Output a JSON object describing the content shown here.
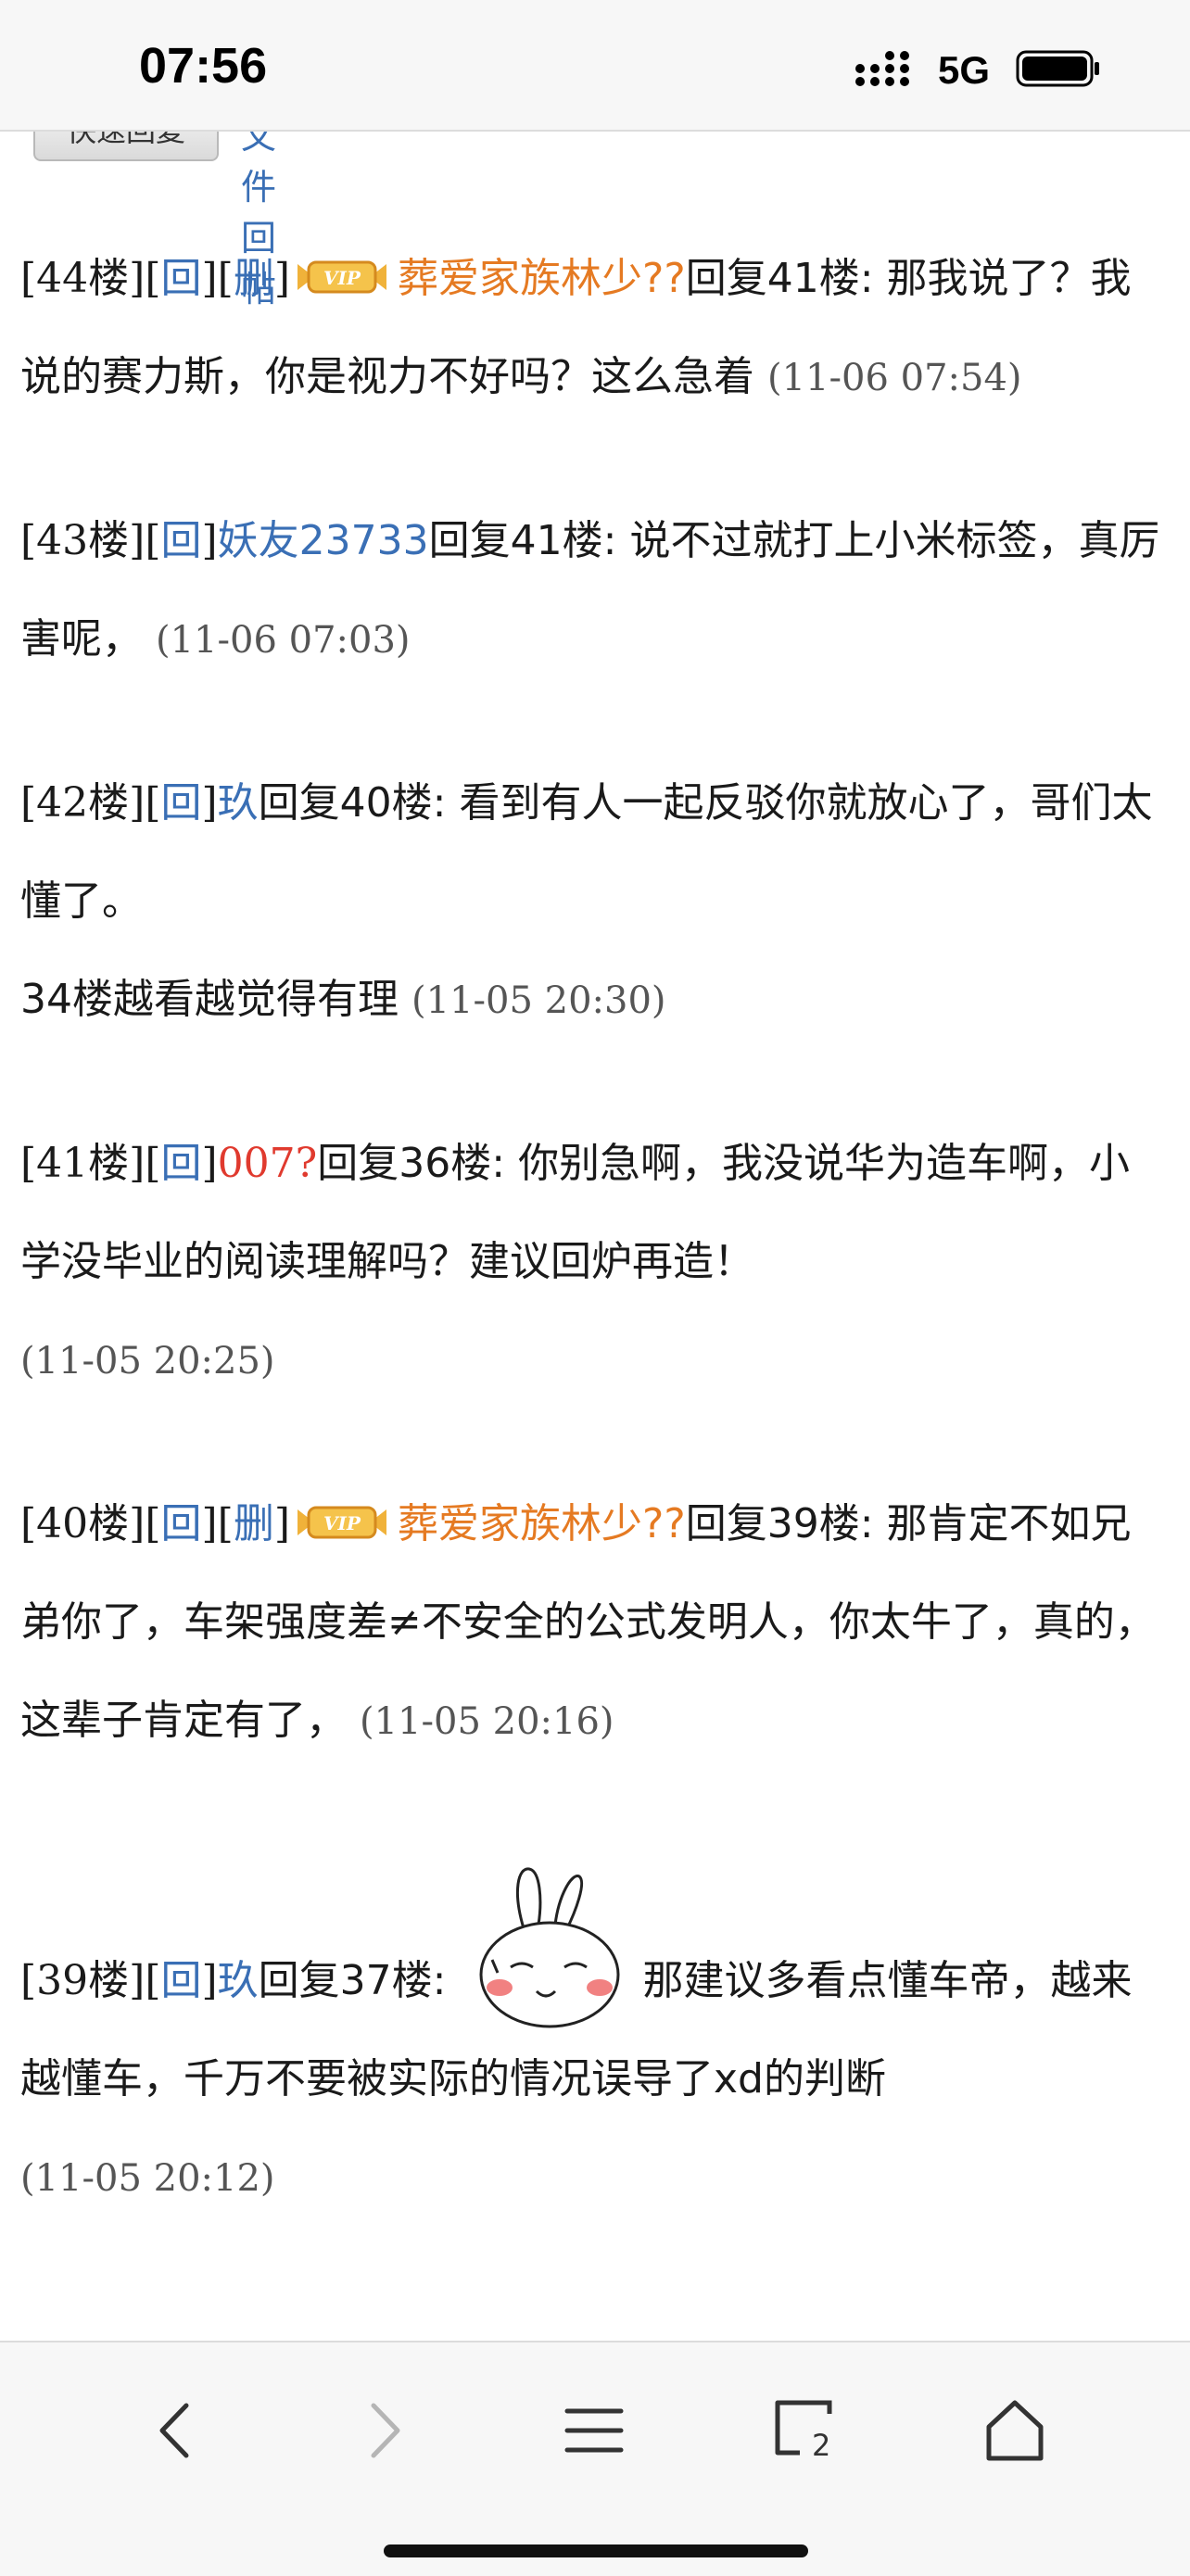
{
  "status_bar": {
    "time": "07:56",
    "network": "5G"
  },
  "top_partial": {
    "button_label": "快速回复",
    "link_label": "文件回帖"
  },
  "posts": [
    {
      "floor": "[44楼]",
      "reply": "回",
      "delete": "删",
      "vip": true,
      "user": "葬爱家族林少??",
      "user_color": "#e57a22",
      "reply_to": "回复41楼:",
      "text": "那我说了？我说的赛力斯，你是视力不好吗？这么急着",
      "time": "(11-06 07:54)"
    },
    {
      "floor": "[43楼]",
      "reply": "回",
      "user": "妖友23733",
      "user_color": "#3a6fb5",
      "reply_to": "回复41楼:",
      "text": "说不过就打上小米标签，真厉害呢，",
      "time": "(11-06 07:03)"
    },
    {
      "floor": "[42楼]",
      "reply": "回",
      "user": "玖",
      "user_color": "#3a6fb5",
      "reply_to": "回复40楼:",
      "text": "看到有人一起反驳你就放心了，哥们太懂了。",
      "text2": "34楼越看越觉得有理",
      "time": "(11-05 20:30)"
    },
    {
      "floor": "[41楼]",
      "reply": "回",
      "user": "007?",
      "user_color": "#e03a2e",
      "reply_to": "回复36楼:",
      "text": "你别急啊，我没说华为造车啊，小学没毕业的阅读理解吗？建议回炉再造！",
      "time": "(11-05 20:25)"
    },
    {
      "floor": "[40楼]",
      "reply": "回",
      "delete": "删",
      "vip": true,
      "user": "葬爱家族林少??",
      "user_color": "#e57a22",
      "reply_to": "回复39楼:",
      "text": "那肯定不如兄弟你了，车架强度差≠不安全的公式发明人，你太牛了，真的，这辈子肯定有了，",
      "time": "(11-05 20:16)"
    },
    {
      "floor": "[39楼]",
      "reply": "回",
      "user": "玖",
      "user_color": "#3a6fb5",
      "reply_to": "回复37楼:",
      "emoji": "rabbit-emoji",
      "text": "那建议多看点懂车帝，越来越懂车，千万不要被实际的情况误导了xd的判断",
      "time": "(11-05 20:12)"
    }
  ],
  "bottom_nav": [
    "back-icon",
    "forward-icon",
    "menu-icon",
    "tabs-icon",
    "home-icon"
  ],
  "tabs_count": "2"
}
